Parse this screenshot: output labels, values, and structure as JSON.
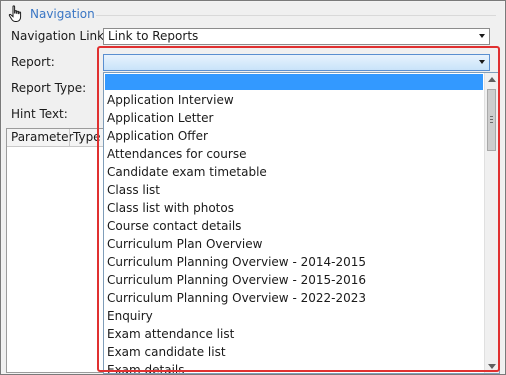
{
  "navigation": {
    "title": "Navigation",
    "link_label": "Navigation Link:",
    "link_value": "Link to Reports",
    "report_label": "Report:",
    "report_value": "",
    "report_type_label": "Report Type:",
    "hint_label": "Hint Text:"
  },
  "params": {
    "col_parameter": "Parameter",
    "col_type": "Type"
  },
  "dropdown": {
    "selected_index": 0,
    "items": [
      "",
      "Application Interview",
      "Application Letter",
      "Application Offer",
      "Attendances for course",
      "Candidate exam timetable",
      "Class list",
      "Class list with photos",
      "Course contact details",
      "Curriculum Plan Overview",
      "Curriculum Planning Overview - 2014-2015",
      "Curriculum Planning Overview - 2015-2016",
      "Curriculum Planning Overview - 2022-2023",
      "Enquiry",
      "Exam attendance list",
      "Exam candidate list",
      "Exam details"
    ]
  },
  "colors": {
    "accent_title": "#3a76c4",
    "selection": "#3399ff",
    "callout_border": "#e03030"
  },
  "icons": {
    "nav_header": "hand-pointer-icon"
  }
}
